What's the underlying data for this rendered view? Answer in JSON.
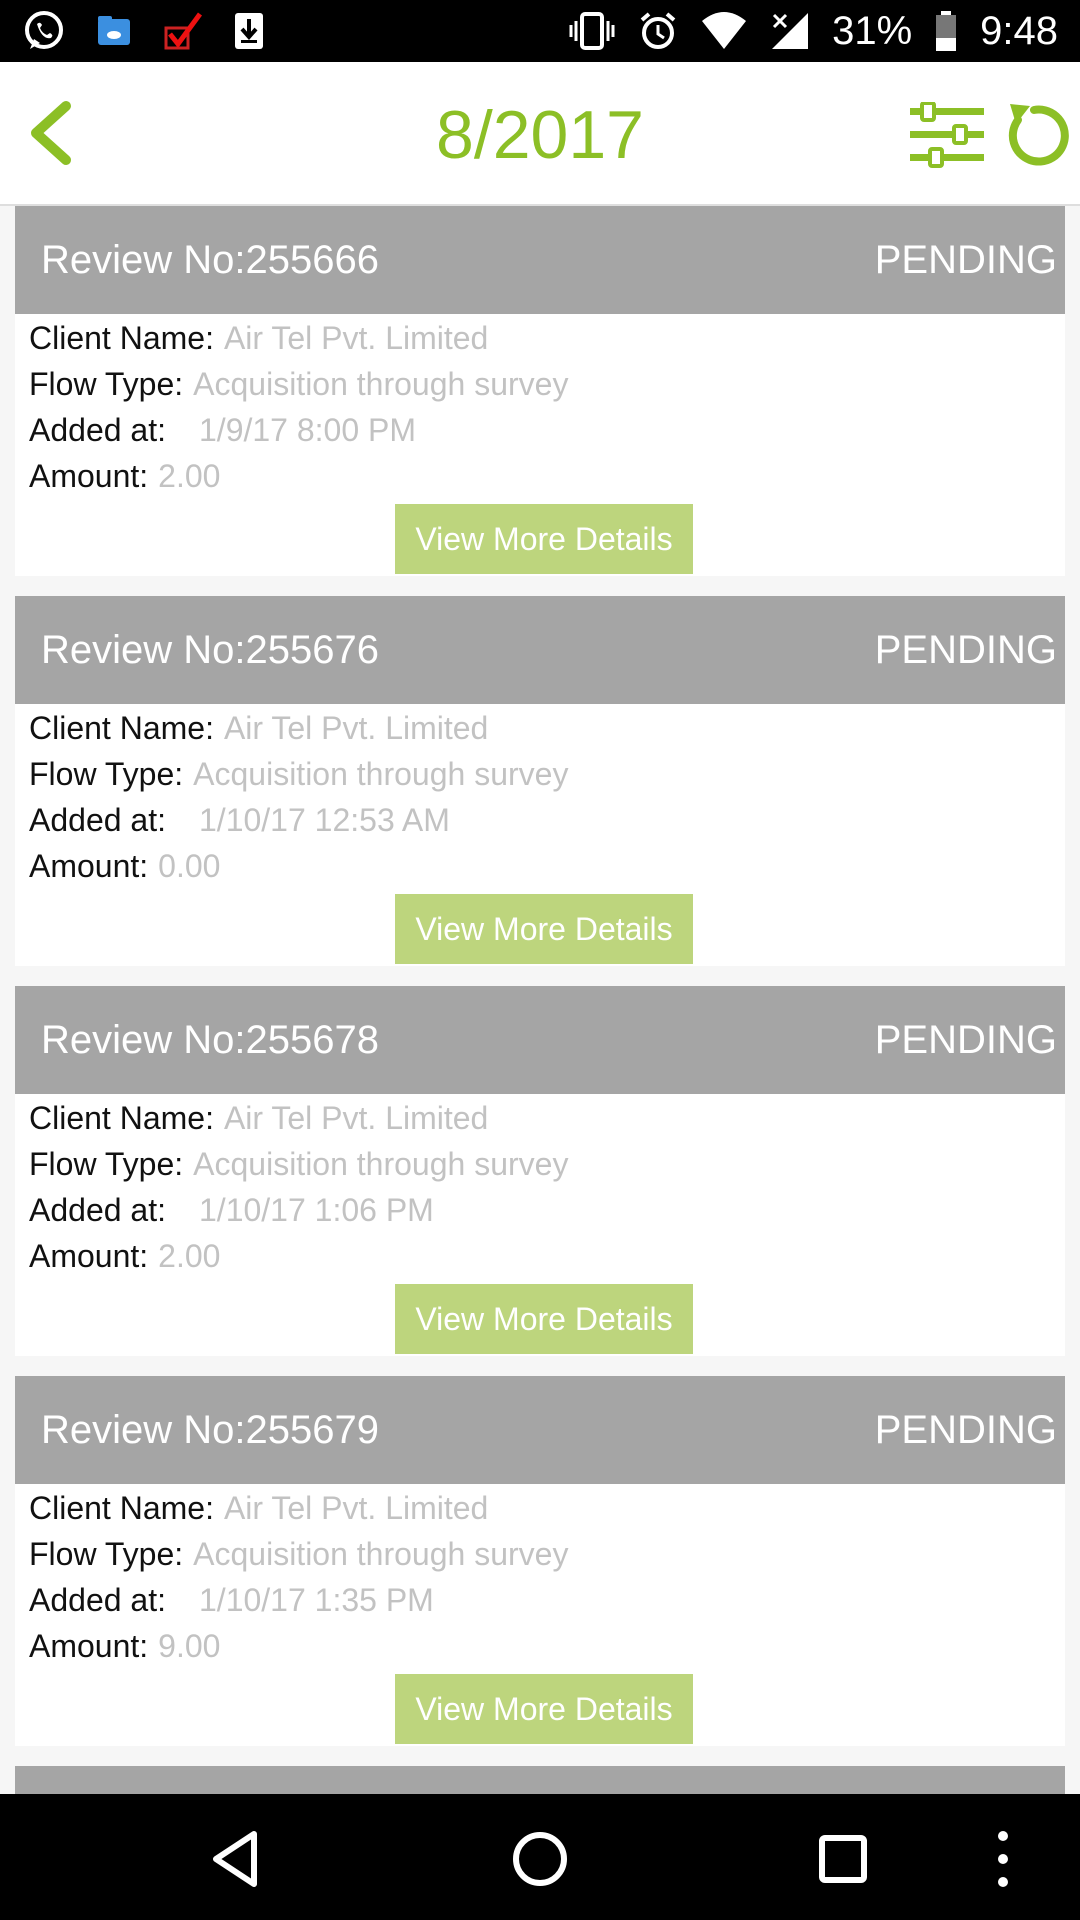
{
  "status_bar": {
    "battery_percent": "31%",
    "time": "9:48",
    "left_icons": [
      "whatsapp-icon",
      "file-manager-icon",
      "checkmark-app-icon",
      "download-icon"
    ],
    "right_icons": [
      "vibrate-icon",
      "alarm-icon",
      "wifi-icon",
      "signal-icon",
      "battery-icon"
    ]
  },
  "app_bar": {
    "title": "8/2017",
    "accent_color": "#8cbf26"
  },
  "labels": {
    "client_name": "Client Name:",
    "flow_type": "Flow Type:",
    "added_at": "Added at:",
    "amount": "Amount:",
    "button": "View More Details"
  },
  "reviews": [
    {
      "review_no": "Review No:255666",
      "status": "PENDING",
      "client_name": "Air Tel Pvt. Limited",
      "flow_type": "Acquisition through survey",
      "added_at": "1/9/17 8:00 PM",
      "amount": "2.00"
    },
    {
      "review_no": "Review No:255676",
      "status": "PENDING",
      "client_name": "Air Tel Pvt. Limited",
      "flow_type": "Acquisition through survey",
      "added_at": "1/10/17 12:53 AM",
      "amount": "0.00"
    },
    {
      "review_no": "Review No:255678",
      "status": "PENDING",
      "client_name": "Air Tel Pvt. Limited",
      "flow_type": "Acquisition through survey",
      "added_at": "1/10/17 1:06 PM",
      "amount": "2.00"
    },
    {
      "review_no": "Review No:255679",
      "status": "PENDING",
      "client_name": "Air Tel Pvt. Limited",
      "flow_type": "Acquisition through survey",
      "added_at": "1/10/17 1:35 PM",
      "amount": "9.00"
    }
  ],
  "colors": {
    "card_header": "#a5a5a5",
    "button": "#bdd57d",
    "value_text": "#c2c2c2"
  }
}
